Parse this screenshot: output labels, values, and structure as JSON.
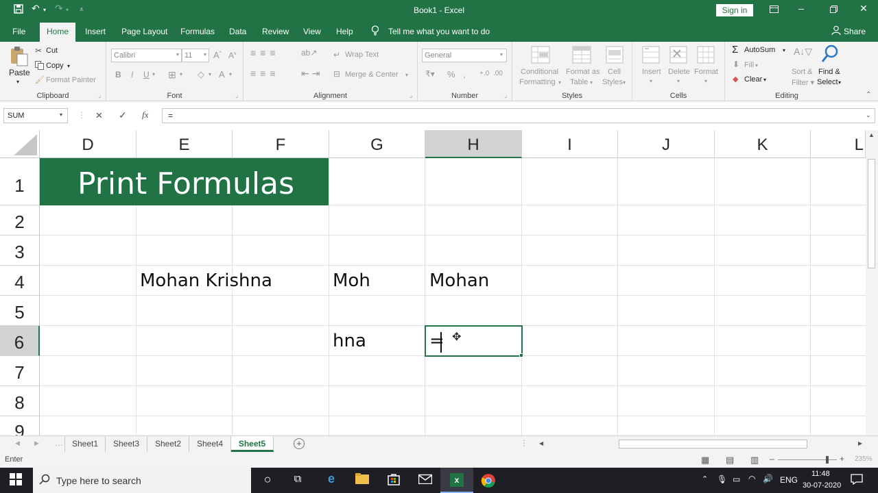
{
  "window": {
    "title": "Book1  -  Excel",
    "sign_in": "Sign in",
    "share": "Share"
  },
  "tabs": [
    "File",
    "Home",
    "Insert",
    "Page Layout",
    "Formulas",
    "Data",
    "Review",
    "View",
    "Help"
  ],
  "tell_me": "Tell me what you want to do",
  "ribbon": {
    "clipboard": {
      "paste": "Paste",
      "cut": "Cut",
      "copy": "Copy",
      "format_painter": "Format Painter",
      "label": "Clipboard"
    },
    "font": {
      "name": "Calibri",
      "size": "11",
      "label": "Font"
    },
    "alignment": {
      "wrap": "Wrap Text",
      "merge": "Merge & Center",
      "label": "Alignment"
    },
    "number": {
      "format": "General",
      "label": "Number"
    },
    "styles": {
      "cond1": "Conditional",
      "cond2": "Formatting",
      "fmt1": "Format as",
      "fmt2": "Table",
      "cell1": "Cell",
      "cell2": "Styles",
      "label": "Styles"
    },
    "cells": {
      "insert": "Insert",
      "delete": "Delete",
      "format": "Format",
      "label": "Cells"
    },
    "editing": {
      "autosum": "AutoSum",
      "fill": "Fill",
      "clear": "Clear",
      "find1": "Find &",
      "find2": "Select",
      "label": "Editing"
    }
  },
  "formula_bar": {
    "name_box": "SUM",
    "cancel": "✕",
    "enter": "✓",
    "fx": "fx",
    "value": "="
  },
  "columns": [
    "D",
    "E",
    "F",
    "G",
    "H",
    "I",
    "J",
    "K",
    "L"
  ],
  "rows": [
    "1",
    "2",
    "3",
    "4",
    "5",
    "6",
    "7",
    "8",
    "9"
  ],
  "cells": {
    "title": "Print Formulas",
    "e4": "Mohan Krishna",
    "g4": "Moh",
    "h4": "Mohan",
    "g6": "hna",
    "h6": "="
  },
  "sheets": [
    "Sheet1",
    "Sheet3",
    "Sheet2",
    "Sheet4",
    "Sheet5"
  ],
  "active_sheet": "Sheet5",
  "status": {
    "mode": "Enter",
    "zoom": "235%"
  },
  "taskbar": {
    "search_placeholder": "Type here to search",
    "lang": "ENG",
    "time": "11:48",
    "date": "30-07-2020"
  },
  "colors": {
    "excel_green": "#217346",
    "title_fill": "#217346"
  }
}
